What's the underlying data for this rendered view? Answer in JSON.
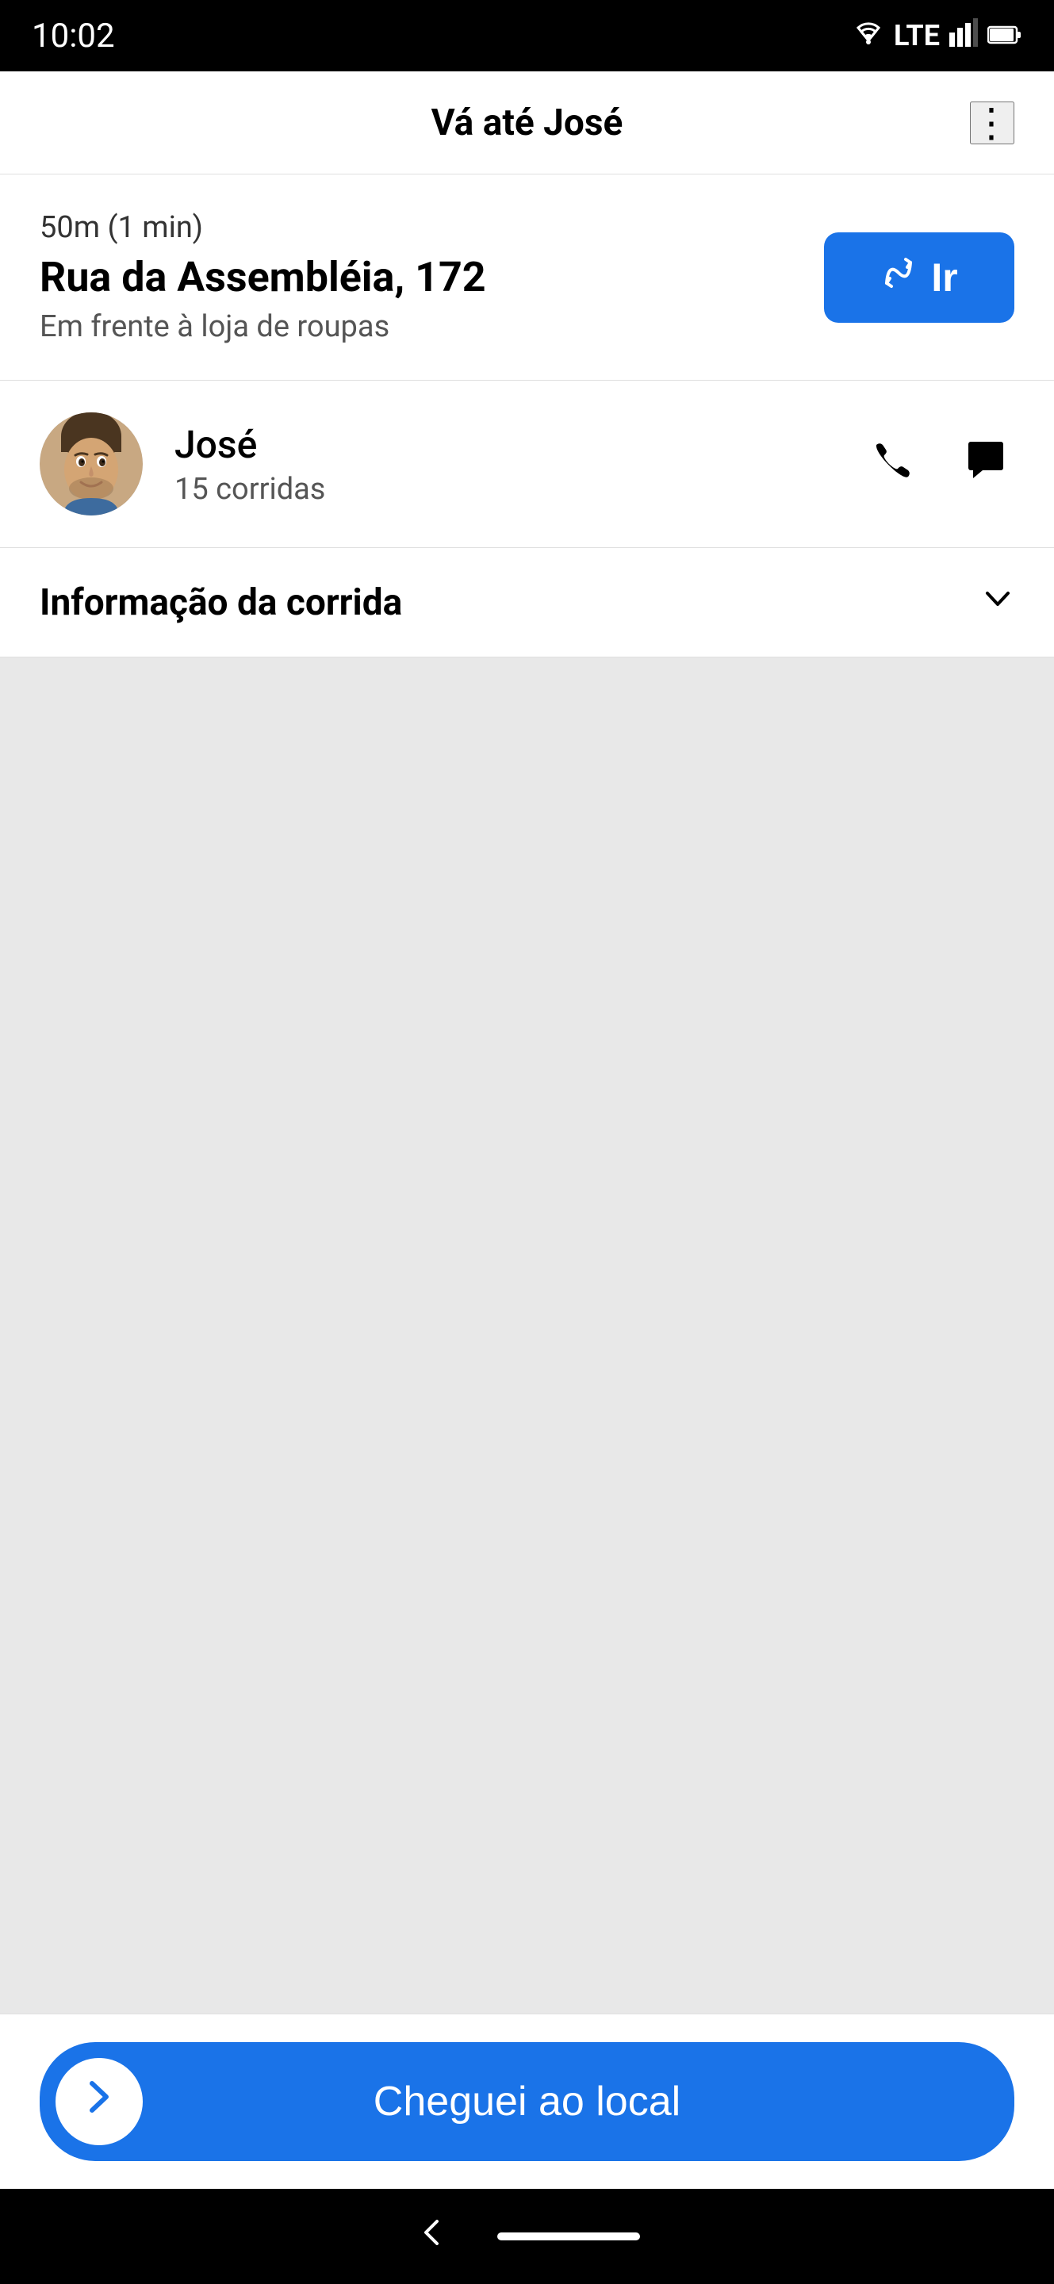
{
  "statusBar": {
    "time": "10:02",
    "wifiIcon": "wifi",
    "lteLabel": "LTE",
    "signalIcon": "signal",
    "batteryIcon": "battery"
  },
  "appBar": {
    "title": "Vá até José",
    "menuIcon": "more-vertical"
  },
  "destination": {
    "distance": "50m (1 min)",
    "address": "Rua da Assembléia, 172",
    "note": "Em frente à loja de roupas",
    "goButtonLabel": "Ir",
    "goButtonIcon": "route"
  },
  "driver": {
    "name": "José",
    "rides": "15 corridas",
    "phoneIcon": "phone",
    "chatIcon": "chat"
  },
  "rideInfo": {
    "label": "Informação da corrida",
    "chevronIcon": "chevron-down"
  },
  "bottomAction": {
    "arrivedLabel": "Cheguei ao local",
    "arrowIcon": "chevron-right"
  },
  "navBar": {
    "backIcon": "arrow-left",
    "homeIndicator": ""
  }
}
